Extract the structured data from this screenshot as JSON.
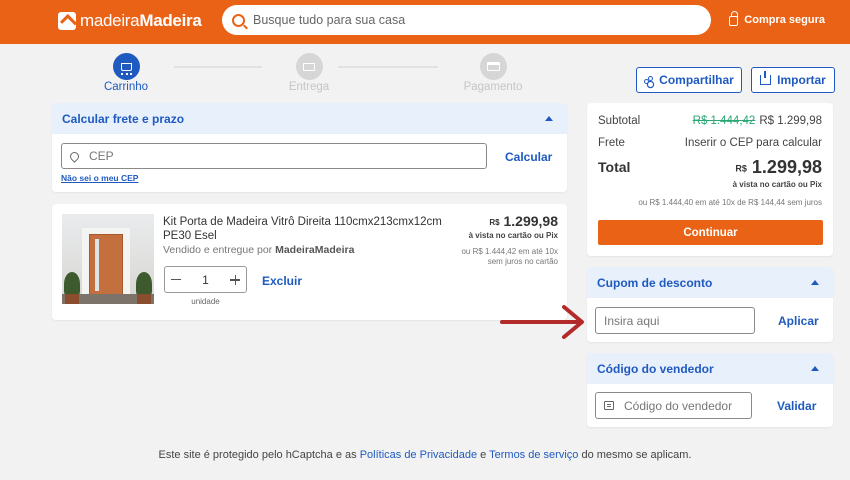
{
  "header": {
    "logo_part1": "madeira",
    "logo_part2": "Madeira",
    "search_placeholder": "Busque tudo para sua casa",
    "secure_label": "Compra segura",
    "brand_color": "#ea6216"
  },
  "steps": [
    {
      "label": "Carrinho",
      "icon": "cart-icon",
      "active": true
    },
    {
      "label": "Entrega",
      "icon": "truck-icon",
      "active": false
    },
    {
      "label": "Pagamento",
      "icon": "credit-card-icon",
      "active": false
    }
  ],
  "actions": {
    "share_label": "Compartilhar",
    "import_label": "Importar"
  },
  "shipping": {
    "title": "Calcular frete e prazo",
    "cep_placeholder": "CEP",
    "calc_label": "Calcular",
    "unknown_cep_link": "Não sei o meu CEP"
  },
  "cart_item": {
    "name": "Kit Porta de Madeira Vitrô Direita 110cmx213cmx12cm PE30 Esel",
    "seller_prefix": "Vendido e entregue por ",
    "seller": "MadeiraMadeira",
    "currency": "R$",
    "price": "1.299,98",
    "price_note": "à vista no cartão ou Pix",
    "installment_line1": "ou R$ 1.444,42 em até 10x",
    "installment_line2": "sem juros no cartão",
    "quantity": "1",
    "quantity_unit": "unidade",
    "remove_label": "Excluir"
  },
  "summary": {
    "subtotal_label": "Subtotal",
    "subtotal_old": "R$ 1.444,42",
    "subtotal_new": "R$ 1.299,98",
    "shipping_label": "Frete",
    "shipping_value": "Inserir o CEP para calcular",
    "total_label": "Total",
    "total_currency": "R$",
    "total_value": "1.299,98",
    "total_note": "à vista no cartão ou Pix",
    "installments": "ou R$ 1.444,40 em até 10x de R$ 144,44 sem juros",
    "continue_label": "Continuar"
  },
  "coupon": {
    "title": "Cupom de desconto",
    "placeholder": "Insira aqui",
    "apply_label": "Aplicar"
  },
  "seller_code": {
    "title": "Código do vendedor",
    "placeholder": "Código do vendedor",
    "validate_label": "Validar"
  },
  "footer": {
    "text_before": "Este site é protegido pelo hCaptcha e as ",
    "privacy_link": "Políticas de Privacidade",
    "text_middle": " e ",
    "terms_link": "Termos de serviço",
    "text_after": " do mesmo se aplicam."
  },
  "accent_color": "#1f5ac1",
  "annotation_arrow_color": "#b22a2a"
}
